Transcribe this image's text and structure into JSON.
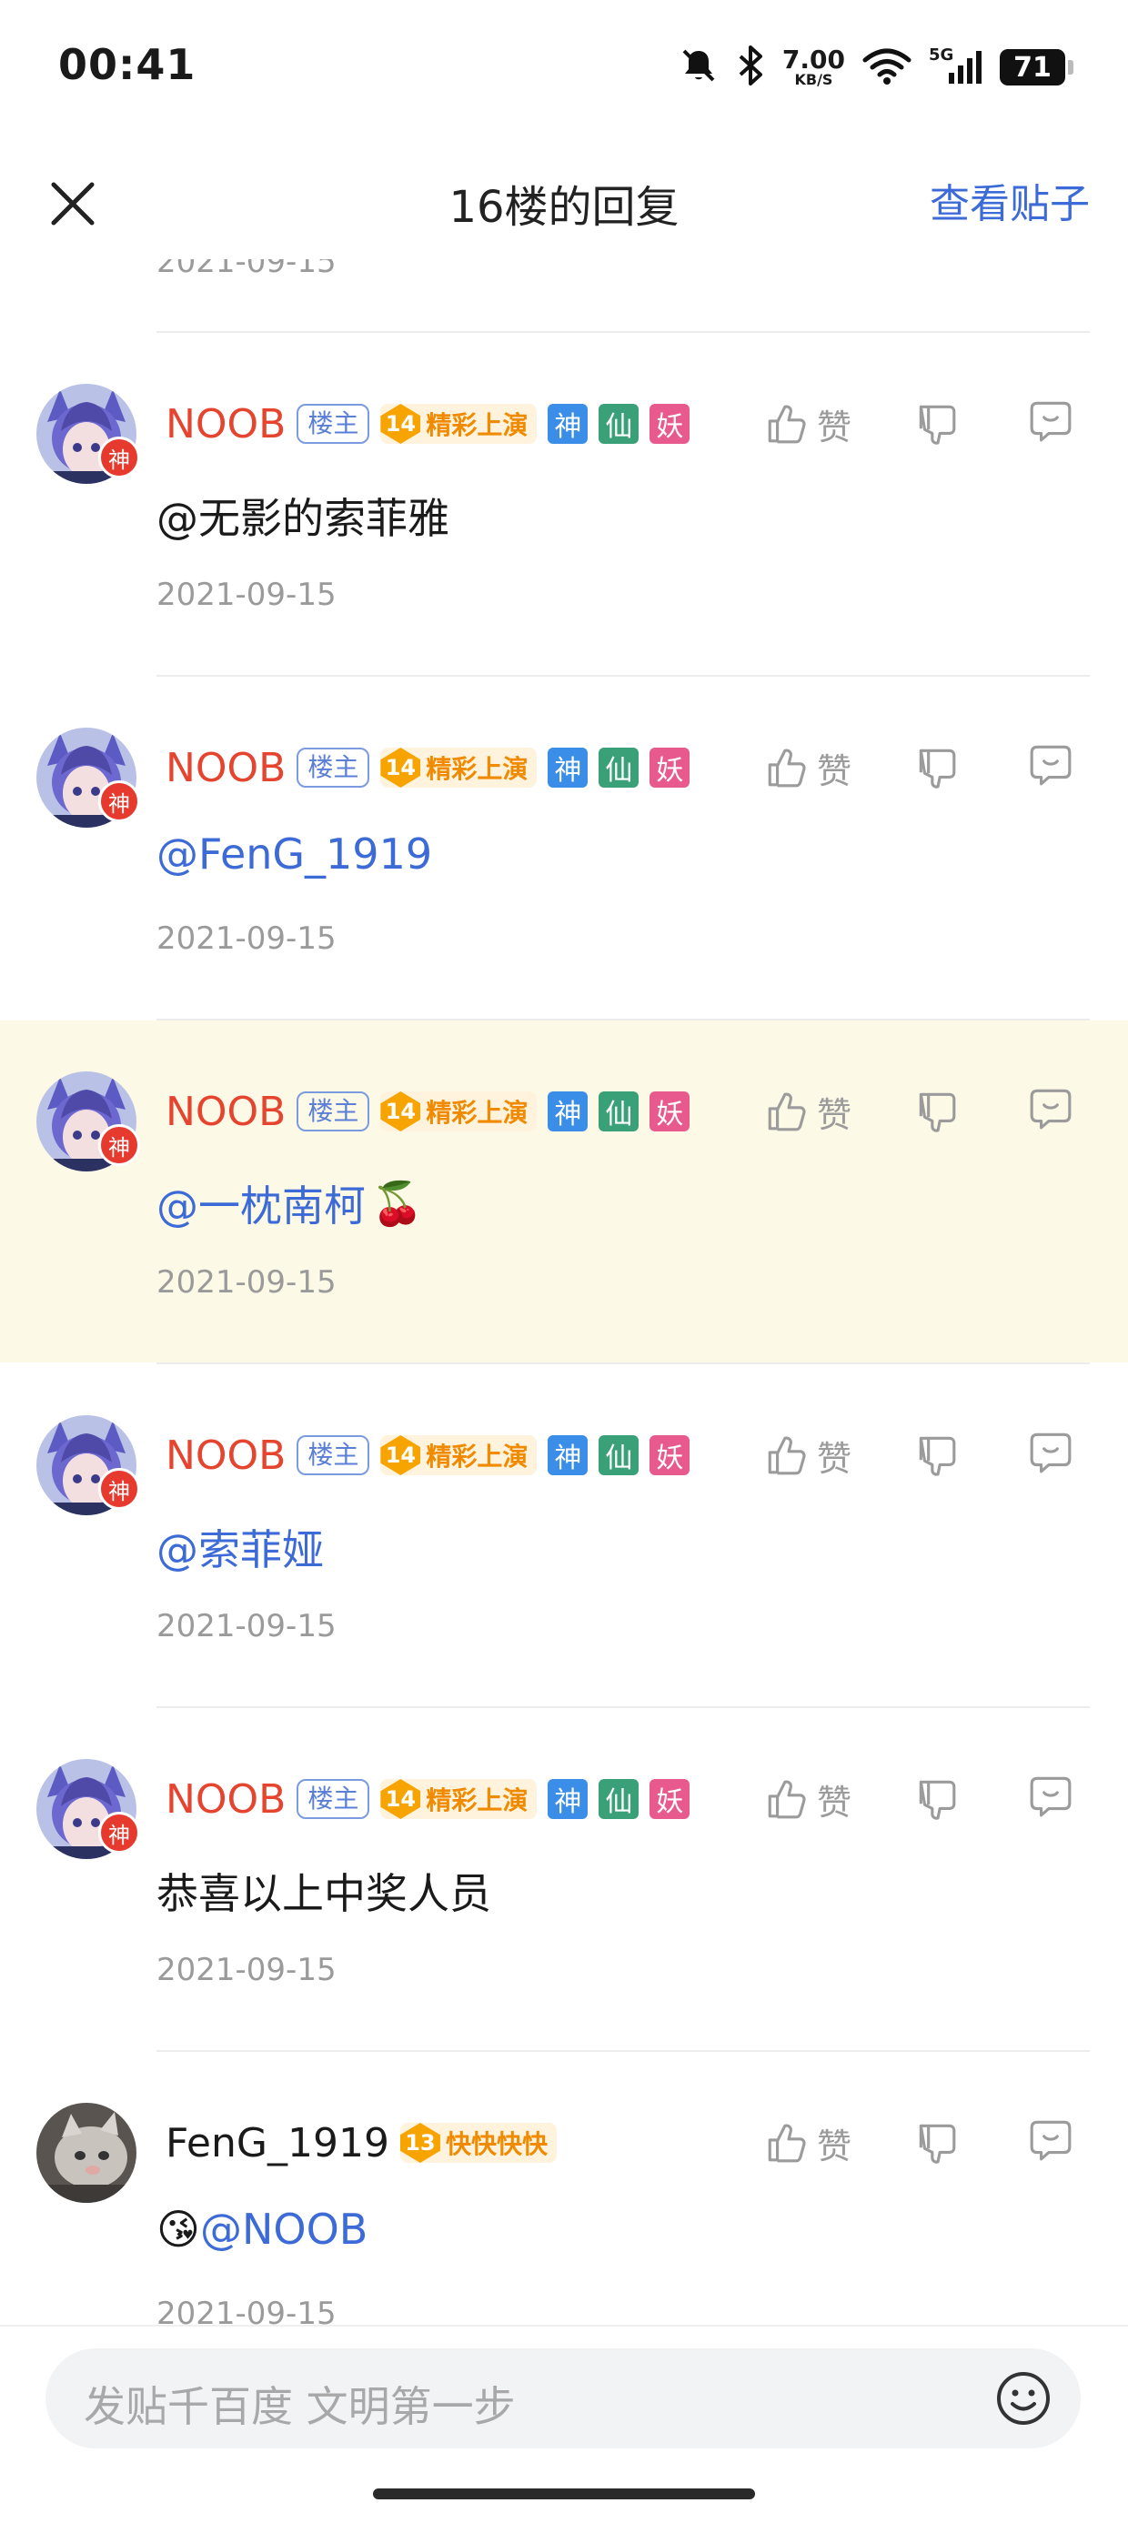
{
  "status_bar": {
    "time": "00:41",
    "net_speed_value": "7.00",
    "net_speed_unit": "KB/S",
    "network": "5G",
    "battery": "71"
  },
  "header": {
    "title": "16楼的回复",
    "view_post": "查看贴子"
  },
  "partial_top_date": "2021-09-15",
  "like_label": "赞",
  "replies": [
    {
      "username": "NOOB",
      "louzhu": "楼主",
      "level": "14",
      "level_title": "精彩上演",
      "tags": [
        "神",
        "仙",
        "妖"
      ],
      "avatar_badge": "神",
      "mention": "",
      "text": "@无影的索菲雅",
      "emoji": "",
      "date": "2021-09-15"
    },
    {
      "username": "NOOB",
      "louzhu": "楼主",
      "level": "14",
      "level_title": "精彩上演",
      "tags": [
        "神",
        "仙",
        "妖"
      ],
      "avatar_badge": "神",
      "mention": "@FenG_1919",
      "text": "",
      "emoji": "",
      "date": "2021-09-15"
    },
    {
      "username": "NOOB",
      "louzhu": "楼主",
      "level": "14",
      "level_title": "精彩上演",
      "tags": [
        "神",
        "仙",
        "妖"
      ],
      "avatar_badge": "神",
      "mention": "@一枕南柯",
      "text": "",
      "emoji": "🍒",
      "date": "2021-09-15"
    },
    {
      "username": "NOOB",
      "louzhu": "楼主",
      "level": "14",
      "level_title": "精彩上演",
      "tags": [
        "神",
        "仙",
        "妖"
      ],
      "avatar_badge": "神",
      "mention": "@索菲娅",
      "text": "",
      "emoji": "",
      "date": "2021-09-15"
    },
    {
      "username": "NOOB",
      "louzhu": "楼主",
      "level": "14",
      "level_title": "精彩上演",
      "tags": [
        "神",
        "仙",
        "妖"
      ],
      "avatar_badge": "神",
      "mention": "",
      "text": "恭喜以上中奖人员",
      "emoji": "",
      "date": "2021-09-15"
    },
    {
      "username": "FenG_1919",
      "level": "13",
      "level_title": "快快快快",
      "lead_emoji": "😘",
      "mention": "@NOOB",
      "date": "2021-09-15"
    }
  ],
  "input": {
    "placeholder": "发贴千百度 文明第一步"
  },
  "colors": {
    "link": "#3c6ad6",
    "author_name": "#e5442f",
    "highlight_bg": "#fdf9e7"
  }
}
